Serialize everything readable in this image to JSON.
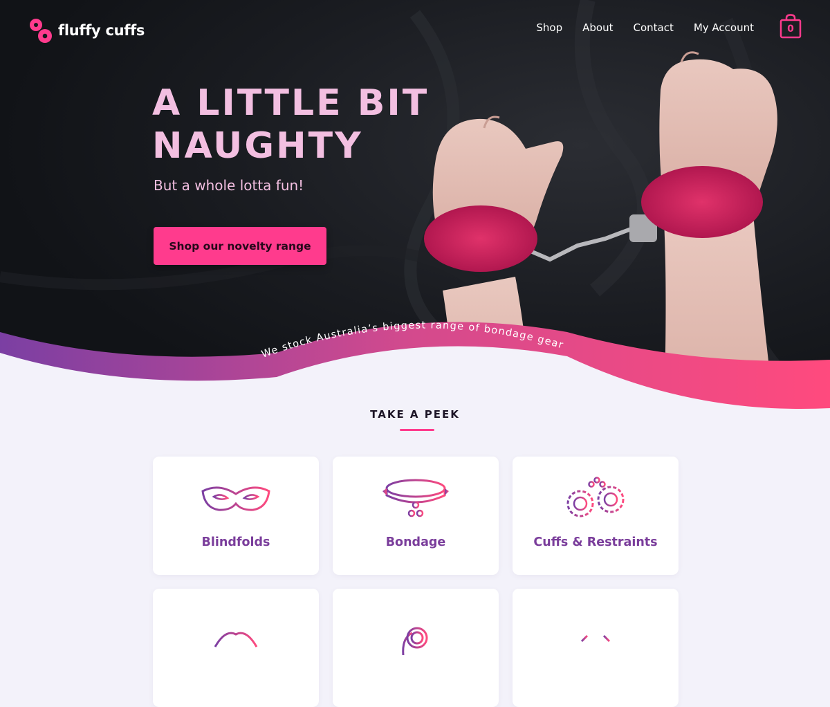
{
  "brand": {
    "name": "fluffy cuffs"
  },
  "nav": {
    "items": [
      {
        "label": "Shop"
      },
      {
        "label": "About"
      },
      {
        "label": "Contact"
      },
      {
        "label": "My Account"
      }
    ],
    "cart_count": "0",
    "cart_icon": "shopping-bag-icon"
  },
  "hero": {
    "title_line1": "A LITTLE BIT",
    "title_line2": "NAUGHTY",
    "subtitle": "But a whole lotta fun!",
    "cta_label": "Shop our novelty range",
    "banner_text": "We stock Australia’s biggest range of bondage gear"
  },
  "section": {
    "title": "TAKE A PEEK"
  },
  "categories": [
    {
      "label": "Blindfolds",
      "icon": "mask-icon"
    },
    {
      "label": "Bondage",
      "icon": "collar-icon"
    },
    {
      "label": "Cuffs & Restraints",
      "icon": "fluffy-cuffs-icon"
    },
    {
      "label": "",
      "icon": "lips-icon"
    },
    {
      "label": "",
      "icon": "whip-icon"
    },
    {
      "label": "",
      "icon": "category-icon"
    }
  ],
  "colors": {
    "accent": "#ff3b8d",
    "title_pink": "#f3bfe1",
    "label_purple": "#7a3d9b",
    "wave_start": "#7b3fa3",
    "wave_end": "#ff4a7e",
    "page_bg": "#f3f2fa",
    "hero_bg": "#15171c"
  }
}
